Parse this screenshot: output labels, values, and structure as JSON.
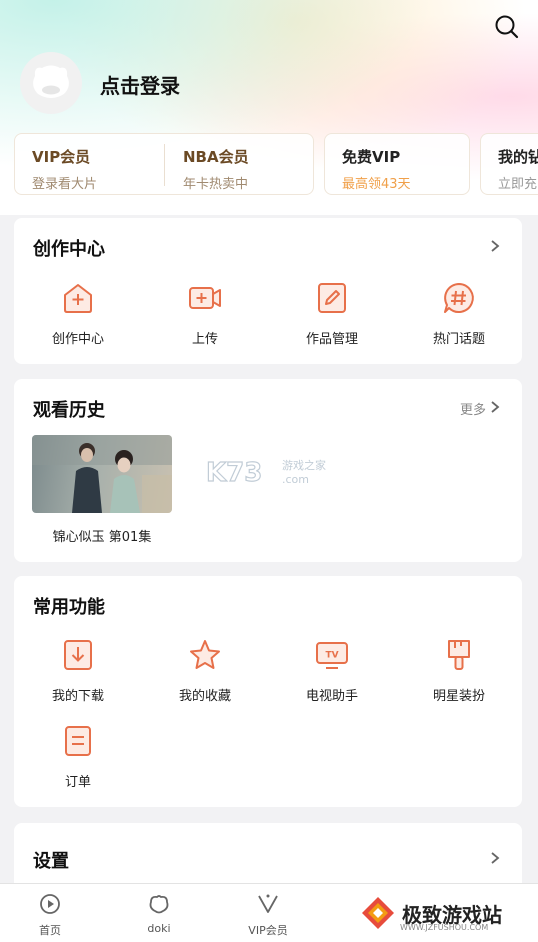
{
  "header": {
    "login_text": "点击登录"
  },
  "vip_cards": [
    {
      "title": "VIP会员",
      "subtitle": "登录看大片"
    },
    {
      "title": "NBA会员",
      "subtitle": "年卡热卖中"
    },
    {
      "title": "免费VIP",
      "subtitle": "最高领43天"
    },
    {
      "title": "我的钻",
      "subtitle": "立即充"
    }
  ],
  "creation": {
    "title": "创作中心",
    "items": [
      {
        "label": "创作中心",
        "icon": "home-plus-icon"
      },
      {
        "label": "上传",
        "icon": "video-camera-plus-icon"
      },
      {
        "label": "作品管理",
        "icon": "edit-pencil-icon"
      },
      {
        "label": "热门话题",
        "icon": "hashtag-chat-icon"
      }
    ]
  },
  "history": {
    "title": "观看历史",
    "more": "更多",
    "items": [
      {
        "title": "锦心似玉 第01集"
      }
    ],
    "watermark": {
      "logo": "K73",
      "line1": "游戏之家",
      "line2": ".com"
    }
  },
  "common": {
    "title": "常用功能",
    "items": [
      {
        "label": "我的下载",
        "icon": "download-icon"
      },
      {
        "label": "我的收藏",
        "icon": "star-icon"
      },
      {
        "label": "电视助手",
        "icon": "tv-icon"
      },
      {
        "label": "明星装扮",
        "icon": "brush-icon"
      },
      {
        "label": "订单",
        "icon": "order-list-icon"
      }
    ]
  },
  "settings": {
    "title": "设置"
  },
  "bottom_nav": [
    {
      "label": "首页",
      "icon": "home-play-icon"
    },
    {
      "label": "doki",
      "icon": "doki-icon"
    },
    {
      "label": "VIP会员",
      "icon": "vip-v-icon"
    }
  ],
  "brand": {
    "name": "极致游戏站",
    "url": "WWW.JZFUSHOU.COM"
  },
  "colors": {
    "accent": "#e7704a",
    "vip_gold": "#6b4a25",
    "vip_orange": "#f0a04a"
  }
}
